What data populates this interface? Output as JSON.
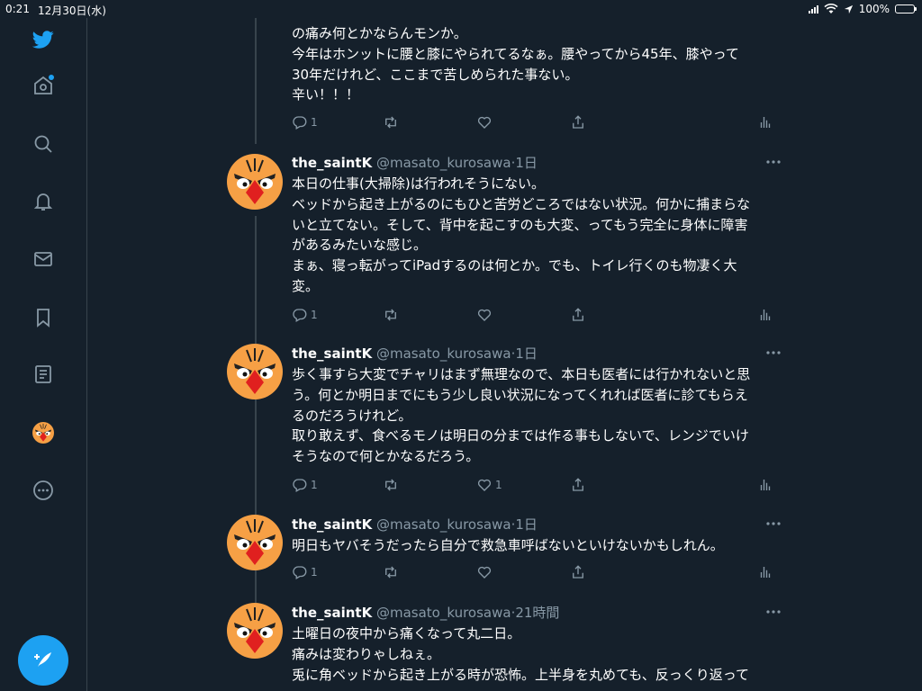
{
  "status_bar": {
    "time": "0:21",
    "date": "12月30日(水)",
    "battery": "100%",
    "battery_level": 1.0
  },
  "sidebar": {
    "items": [
      {
        "name": "twitter-logo-icon"
      },
      {
        "name": "home-icon"
      },
      {
        "name": "explore-icon"
      },
      {
        "name": "notifications-icon"
      },
      {
        "name": "messages-icon"
      },
      {
        "name": "bookmarks-icon"
      },
      {
        "name": "lists-icon"
      },
      {
        "name": "profile-icon"
      },
      {
        "name": "more-icon"
      }
    ],
    "compose_icon": "compose-tweet-icon"
  },
  "timeline": {
    "tweets": [
      {
        "partial": true,
        "lines": [
          "の痛み何とかならんモンか。",
          "今年はホンットに腰と膝にやられてるなぁ。腰やってから45年、膝やって",
          "30年だけれど、ここまで苦しめられた事ない。",
          "辛い！！！"
        ],
        "reply_count": "1",
        "retweet_count": "",
        "like_count": ""
      },
      {
        "name": "the_saintK",
        "handle": "@masato_kurosawa",
        "time": "·1日",
        "lines": [
          "本日の仕事(大掃除)は行われそうにない。",
          "ベッドから起き上がるのにもひと苦労どころではない状況。何かに捕まらな",
          "いと立てない。そして、背中を起こすのも大変、ってもう完全に身体に障害",
          "があるみたいな感じ。",
          "まぁ、寝っ転がってiPadするのは何とか。でも、トイレ行くのも物凄く大",
          "変。"
        ],
        "reply_count": "1",
        "retweet_count": "",
        "like_count": ""
      },
      {
        "name": "the_saintK",
        "handle": "@masato_kurosawa",
        "time": "·1日",
        "lines": [
          "歩く事すら大変でチャリはまず無理なので、本日も医者には行かれないと思",
          "う。何とか明日までにもう少し良い状況になってくれれば医者に診てもらえ",
          "るのだろうけれど。",
          "取り敢えず、食べるモノは明日の分までは作る事もしないで、レンジでいけ",
          "そうなので何とかなるだろう。"
        ],
        "reply_count": "1",
        "retweet_count": "",
        "like_count": "1"
      },
      {
        "name": "the_saintK",
        "handle": "@masato_kurosawa",
        "time": "·1日",
        "lines": [
          "明日もヤバそうだったら自分で救急車呼ばないといけないかもしれん。"
        ],
        "reply_count": "1",
        "retweet_count": "",
        "like_count": ""
      },
      {
        "name": "the_saintK",
        "handle": "@masato_kurosawa",
        "time": "·21時間",
        "lines": [
          "土曜日の夜中から痛くなって丸二日。",
          "痛みは変わりゃしねぇ。",
          "兎に角ベッドから起き上がる時が恐怖。上半身を丸めても、反っくり返って"
        ],
        "reply_count": "",
        "retweet_count": "",
        "like_count": ""
      }
    ]
  }
}
